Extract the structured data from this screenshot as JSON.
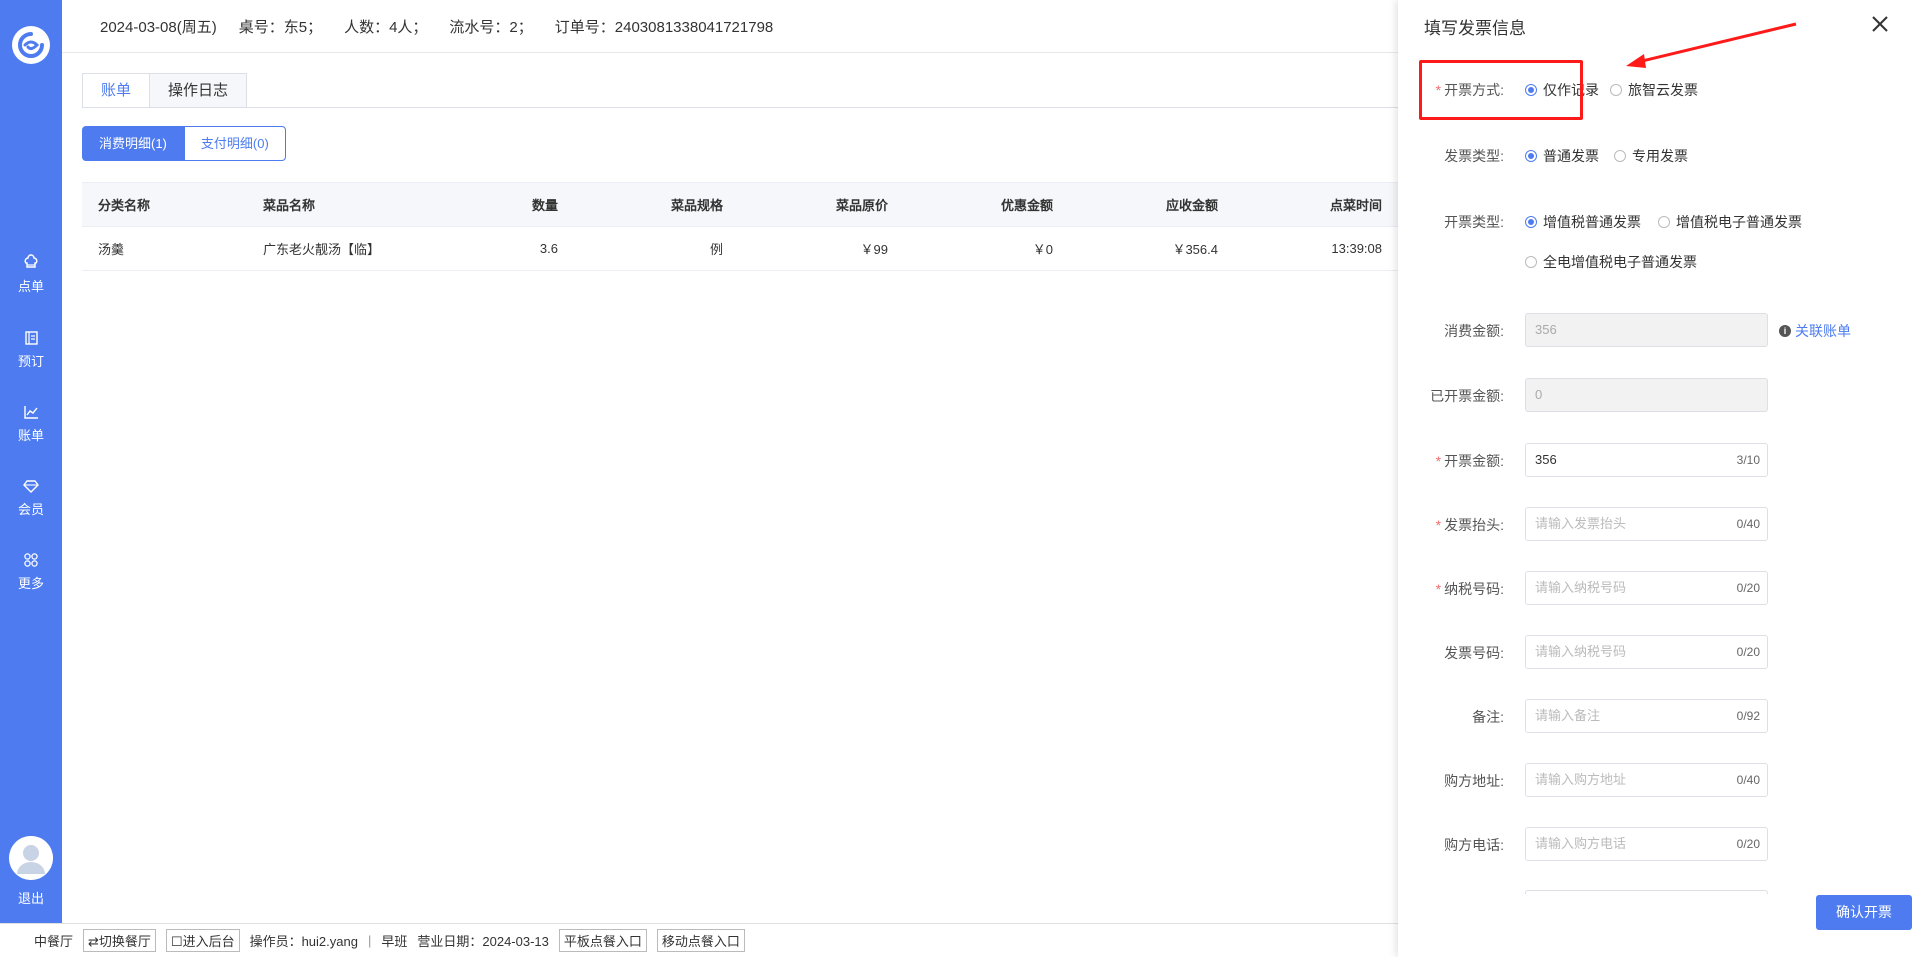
{
  "sidebar": {
    "items": [
      {
        "label": "点单",
        "icon": "chef-hat-icon"
      },
      {
        "label": "预订",
        "icon": "book-icon"
      },
      {
        "label": "账单",
        "icon": "chart-icon"
      },
      {
        "label": "会员",
        "icon": "diamond-icon"
      },
      {
        "label": "更多",
        "icon": "grid-icon"
      }
    ],
    "logout": "退出"
  },
  "topbar": {
    "date": "2024-03-08(周五)",
    "table": "桌号：东5；",
    "people": "人数：4人；",
    "serial": "流水号：2；",
    "order": "订单号：2403081338041721798"
  },
  "tabs": [
    {
      "label": "账单",
      "active": true
    },
    {
      "label": "操作日志",
      "active": false
    }
  ],
  "segments": [
    {
      "label": "消费明细(1)",
      "active": true
    },
    {
      "label": "支付明细(0)",
      "active": false
    }
  ],
  "table": {
    "headers": [
      "分类名称",
      "菜品名称",
      "数量",
      "菜品规格",
      "菜品原价",
      "优惠金额",
      "应收金额",
      "点菜时间"
    ],
    "rows": [
      [
        "汤羹",
        "广东老火靓汤【临】",
        "3.6",
        "例",
        "￥99",
        "￥0",
        "￥356.4",
        "13:39:08"
      ]
    ]
  },
  "statusbar": {
    "hall": "中餐厅",
    "switch_hall": "⇄切换餐厅",
    "enter_backend": "☐进入后台",
    "operator": "操作员：hui2.yang",
    "sep": "|",
    "shift": "早班",
    "business_date": "营业日期：2024-03-13",
    "tablet_entry": "平板点餐入口",
    "mobile_entry": "移动点餐入口"
  },
  "drawer": {
    "title": "填写发票信息",
    "issue_mode": {
      "label": "开票方式:",
      "options": [
        "仅作记录",
        "旅智云发票"
      ],
      "selected": 0
    },
    "invoice_kind": {
      "label": "发票类型:",
      "options": [
        "普通发票",
        "专用发票"
      ],
      "selected": 0
    },
    "issue_type": {
      "label": "开票类型:",
      "options": [
        "增值税普通发票",
        "增值税电子普通发票",
        "全电增值税电子普通发票"
      ],
      "selected": 0
    },
    "consume_amount": {
      "label": "消费金额:",
      "value": "356",
      "link": "关联账单"
    },
    "issued_amount": {
      "label": "已开票金额:",
      "value": "0"
    },
    "invoice_amount": {
      "label": "开票金额:",
      "value": "356",
      "count": "3/10"
    },
    "invoice_title": {
      "label": "发票抬头:",
      "placeholder": "请输入发票抬头",
      "count": "0/40"
    },
    "tax_number": {
      "label": "纳税号码:",
      "placeholder": "请输入纳税号码",
      "count": "0/20"
    },
    "invoice_number": {
      "label": "发票号码:",
      "placeholder": "请输入纳税号码",
      "count": "0/20"
    },
    "remark": {
      "label": "备注:",
      "placeholder": "请输入备注",
      "count": "0/92"
    },
    "buyer_address": {
      "label": "购方地址:",
      "placeholder": "请输入购方地址",
      "count": "0/40"
    },
    "buyer_phone": {
      "label": "购方电话:",
      "placeholder": "请输入购方电话",
      "count": "0/20"
    },
    "confirm": "确认开票"
  },
  "colors": {
    "accent": "#4e7cf0",
    "highlight": "#ff1a1a",
    "required": "#f56c6c"
  }
}
